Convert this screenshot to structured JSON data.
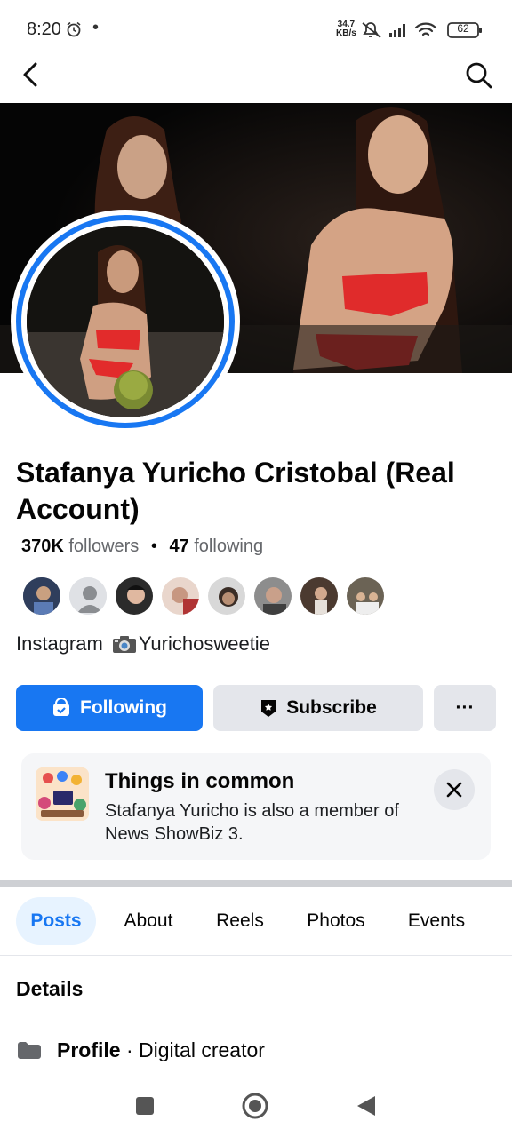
{
  "status_bar": {
    "time": "8:20",
    "dot": "•",
    "speed_value": "34.7",
    "speed_unit": "KB/s",
    "battery": "62",
    "icons": [
      "alarm-icon",
      "mute-icon",
      "signal-icon",
      "wifi-icon",
      "battery-icon"
    ]
  },
  "top_nav": {
    "icons": [
      "back-arrow-icon",
      "search-icon"
    ]
  },
  "profile": {
    "name": "Stafanya Yuricho Cristobal (Real Account)",
    "followers_count": "370K",
    "followers_label": "followers",
    "separator": "•",
    "following_count": "47",
    "following_label": "following",
    "bio_prefix": "Instagram",
    "bio_handle": "Yurichosweetie"
  },
  "mutual_friends": {
    "count_shown": 8
  },
  "actions": {
    "following_label": "Following",
    "subscribe_label": "Subscribe",
    "more_label": "···"
  },
  "things_in_common": {
    "title": "Things in common",
    "text": "Stafanya Yuricho is also a member of News ShowBiz  3."
  },
  "tabs": [
    {
      "label": "Posts",
      "active": true
    },
    {
      "label": "About",
      "active": false
    },
    {
      "label": "Reels",
      "active": false
    },
    {
      "label": "Photos",
      "active": false
    },
    {
      "label": "Events",
      "active": false
    }
  ],
  "details": {
    "title": "Details",
    "profile_label": "Profile",
    "profile_separator": " · ",
    "profile_value": "Digital creator"
  },
  "colors": {
    "accent": "#1877f2",
    "button_gray": "#e4e6eb",
    "card_bg": "#f5f6f8",
    "tab_active_bg": "#e7f3ff"
  }
}
